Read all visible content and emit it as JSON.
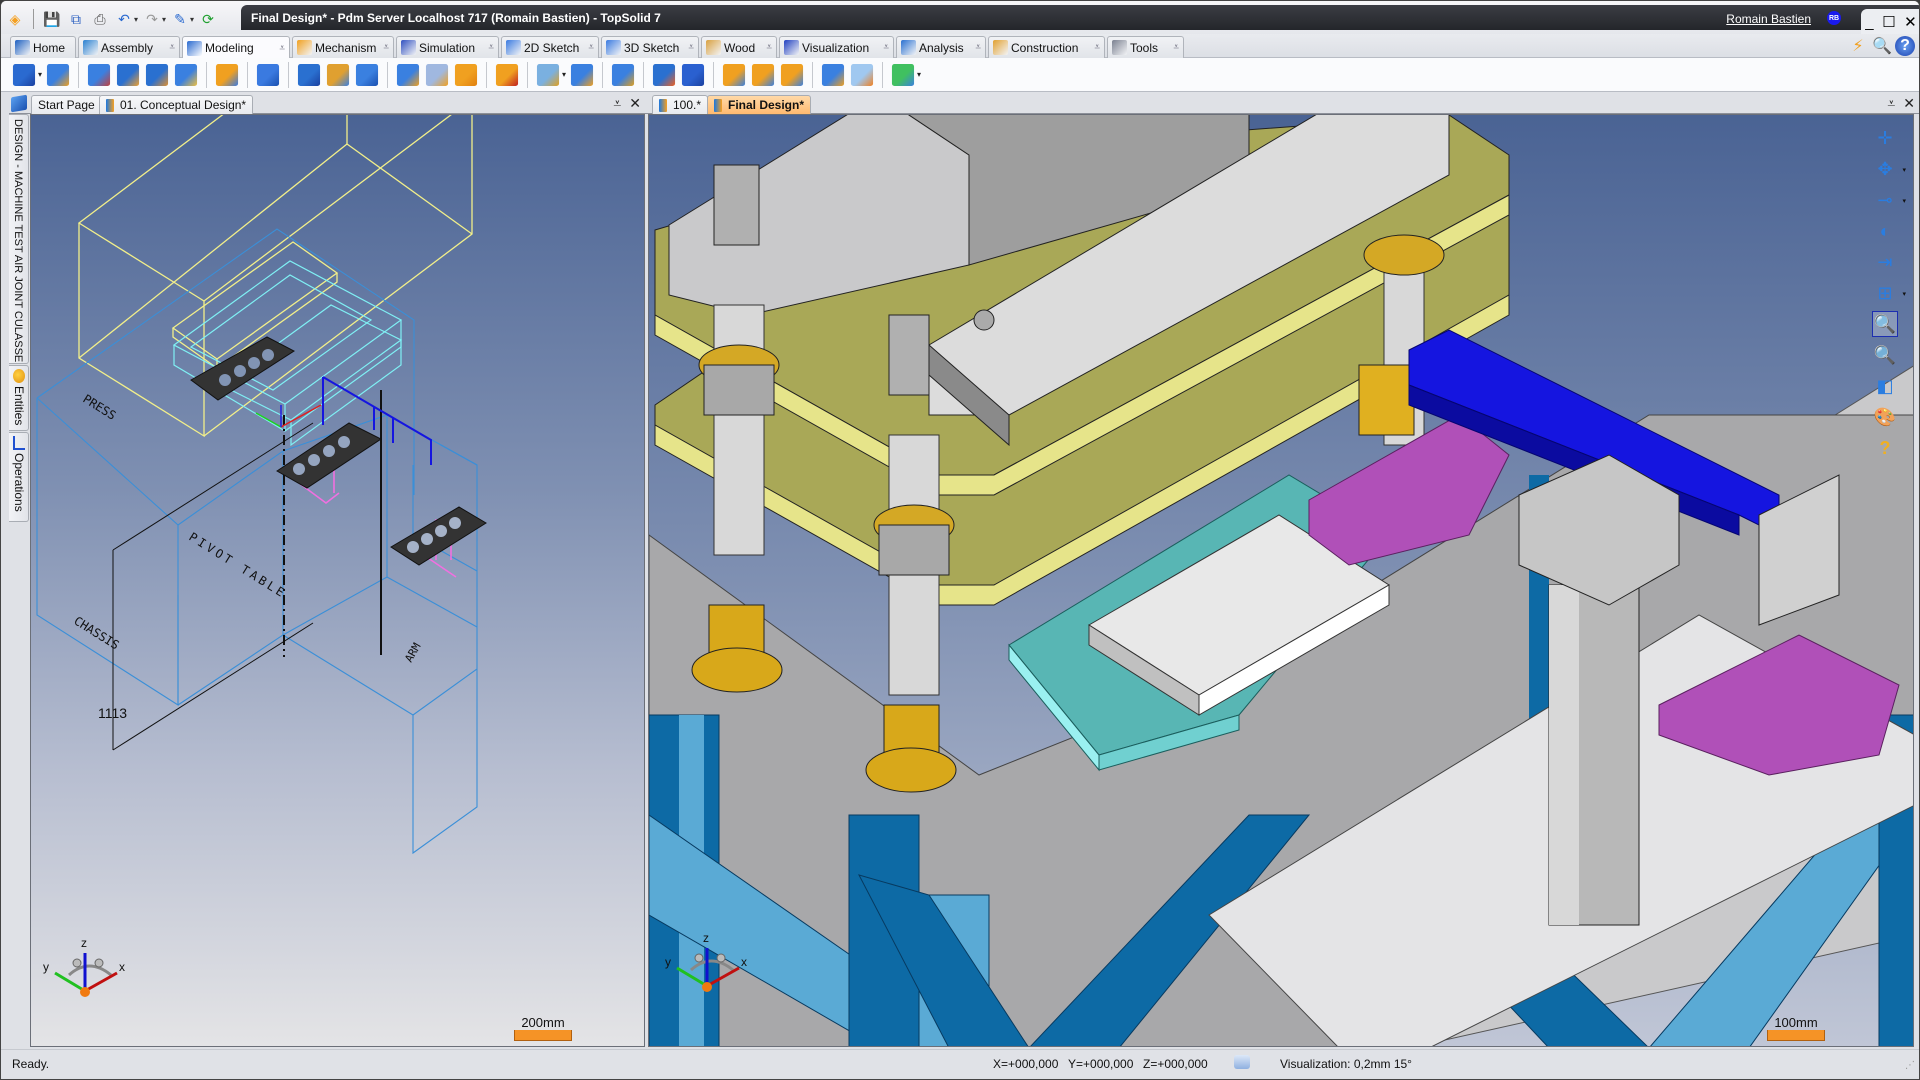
{
  "window": {
    "title": "Final Design* - Pdm Server Localhost 717 (Romain Bastien) - TopSolid 7",
    "user_name": "Romain Bastien",
    "user_initials": "RB",
    "controls": {
      "minimize": "_",
      "maximize": "☐",
      "close": "✕"
    }
  },
  "quick_access": [
    {
      "name": "app-logo-icon",
      "glyph": "◈",
      "color": "#f5a020"
    },
    {
      "name": "save-icon",
      "glyph": "💾",
      "color": "#2a5fc0"
    },
    {
      "name": "save-all-icon",
      "glyph": "⧉",
      "color": "#2a5fc0"
    },
    {
      "name": "print-icon",
      "glyph": "⎙",
      "color": "#555"
    },
    {
      "name": "undo-icon",
      "glyph": "↶",
      "color": "#2a6ad0"
    },
    {
      "name": "redo-icon",
      "glyph": "↷",
      "color": "#999"
    },
    {
      "name": "pen-icon",
      "glyph": "✎",
      "color": "#2a6ad0"
    },
    {
      "name": "refresh-icon",
      "glyph": "⟳",
      "color": "#20a030"
    }
  ],
  "ribbon": {
    "tabs": [
      {
        "label": "Home",
        "color": "#1d5fc0",
        "dropdown": false
      },
      {
        "label": "Assembly",
        "color": "#2a80d0",
        "dropdown": true
      },
      {
        "label": "Modeling",
        "color": "#2a6ad0",
        "dropdown": true,
        "active": true
      },
      {
        "label": "Mechanism",
        "color": "#f0a020",
        "dropdown": true
      },
      {
        "label": "Simulation",
        "color": "#3050c0",
        "dropdown": true
      },
      {
        "label": "2D Sketch",
        "color": "#3a7ae0",
        "dropdown": true
      },
      {
        "label": "3D Sketch",
        "color": "#3a7ae0",
        "dropdown": true
      },
      {
        "label": "Wood",
        "color": "#d8a040",
        "dropdown": true
      },
      {
        "label": "Visualization",
        "color": "#2040c0",
        "dropdown": true
      },
      {
        "label": "Analysis",
        "color": "#2a70d0",
        "dropdown": true
      },
      {
        "label": "Construction",
        "color": "#e0a030",
        "dropdown": true
      },
      {
        "label": "Tools",
        "color": "#7a8090",
        "dropdown": true
      }
    ],
    "right_buttons": [
      {
        "name": "connect-icon",
        "glyph": "⚡"
      },
      {
        "name": "search-icon",
        "glyph": "🔍"
      },
      {
        "name": "help-icon",
        "glyph": "?"
      }
    ]
  },
  "toolbar": {
    "groups": [
      [
        {
          "name": "sketch-part-icon",
          "c1": "#2a6ad0",
          "c2": "#1a40a0",
          "dd": true
        },
        {
          "name": "edit-sketch-icon",
          "c1": "#3a80e0",
          "c2": "#f0a020",
          "dd": false
        }
      ],
      [
        {
          "name": "extrude-profile-icon",
          "c1": "#3a80e0",
          "c2": "#c04040",
          "dd": false
        },
        {
          "name": "extrude-icon",
          "c1": "#2a70d0",
          "c2": "#f0a030",
          "dd": false
        },
        {
          "name": "revolve-icon",
          "c1": "#2a70d0",
          "c2": "#e09030",
          "dd": false
        },
        {
          "name": "shell-icon",
          "c1": "#3a80e0",
          "c2": "#f0c040",
          "dd": false
        }
      ],
      [
        {
          "name": "sweep-icon",
          "c1": "#f0a020",
          "c2": "#3a7ae0",
          "dd": false
        }
      ],
      [
        {
          "name": "layers-icon",
          "c1": "#3a7ae0",
          "c2": "#1a50b0",
          "dd": false
        }
      ],
      [
        {
          "name": "box-icon",
          "c1": "#2a70d0",
          "c2": "#1a40a0",
          "dd": false
        },
        {
          "name": "pattern-icon",
          "c1": "#e0a030",
          "c2": "#3a80e0",
          "dd": false
        },
        {
          "name": "repeat-icon",
          "c1": "#3a80e0",
          "c2": "#1a50b0",
          "dd": false
        }
      ],
      [
        {
          "name": "boolean-icon",
          "c1": "#3a80e0",
          "c2": "#f0a020",
          "dd": false
        },
        {
          "name": "intersect-icon",
          "c1": "#a0b8e0",
          "c2": "#f0a020",
          "dd": false
        },
        {
          "name": "pipe-icon",
          "c1": "#f0a020",
          "c2": "#e08010",
          "dd": false
        }
      ],
      [
        {
          "name": "array-icon",
          "c1": "#f0a020",
          "c2": "#c02020",
          "dd": false
        }
      ],
      [
        {
          "name": "spring-icon",
          "c1": "#7ab0e0",
          "c2": "#e0a020",
          "dd": true
        },
        {
          "name": "fastener-icon",
          "c1": "#3a80e0",
          "c2": "#f0a020",
          "dd": false
        }
      ],
      [
        {
          "name": "insert-icon",
          "c1": "#3a80e0",
          "c2": "#e0a020",
          "dd": false
        }
      ],
      [
        {
          "name": "solid-icon",
          "c1": "#2a70d0",
          "c2": "#f06020",
          "dd": false
        },
        {
          "name": "text-solid-icon",
          "c1": "#2a60d0",
          "c2": "#1a40a0",
          "dd": false
        }
      ],
      [
        {
          "name": "fillet-icon",
          "c1": "#f0a020",
          "c2": "#3a80e0",
          "dd": false
        },
        {
          "name": "chamfer-icon",
          "c1": "#f0a020",
          "c2": "#3a80e0",
          "dd": false
        },
        {
          "name": "draft-icon",
          "c1": "#f0a020",
          "c2": "#3a80e0",
          "dd": false
        }
      ],
      [
        {
          "name": "stack-icon",
          "c1": "#3a80e0",
          "c2": "#f0a020",
          "dd": false
        },
        {
          "name": "cut-icon",
          "c1": "#a0c8f0",
          "c2": "#f08020",
          "dd": false
        }
      ],
      [
        {
          "name": "inspect-icon",
          "c1": "#40c060",
          "c2": "#3a80e0",
          "dd": true
        }
      ]
    ]
  },
  "left_panel": {
    "tabs": [
      {
        "label": "Start Page",
        "active": false,
        "doc_icon": false
      },
      {
        "label": "01. Conceptual Design*",
        "active": false,
        "doc_icon": true
      }
    ],
    "side_tabs": [
      {
        "label": "DESIGN - MACHINE TEST AIR JOINT CULASSE"
      },
      {
        "label": "Entities"
      },
      {
        "label": "Operations"
      }
    ],
    "viewport": {
      "labels": {
        "press": "PRESS",
        "pivot_table": "PIVOT TABLE",
        "chassis": "CHASSIS",
        "arm": "ARM"
      },
      "dimension": "1113",
      "scale": "200mm",
      "axes": {
        "x": "x",
        "y": "y",
        "z": "z"
      }
    }
  },
  "right_panel": {
    "tabs": [
      {
        "label": "100.*",
        "active": false
      },
      {
        "label": "Final Design*",
        "active": true
      }
    ],
    "scale": "100mm",
    "axes": {
      "x": "x",
      "y": "y",
      "z": "z"
    },
    "view_tools": [
      {
        "name": "pan-icon",
        "glyph": "✛",
        "dd": false,
        "selected": false
      },
      {
        "name": "rotate-icon",
        "glyph": "✥",
        "dd": true,
        "selected": false
      },
      {
        "name": "camera-icon",
        "glyph": "⊸",
        "dd": true,
        "selected": false
      },
      {
        "name": "light-icon",
        "glyph": "◐",
        "dd": false,
        "selected": false
      },
      {
        "name": "section-lock-icon",
        "glyph": "⇥",
        "dd": false,
        "selected": false
      },
      {
        "name": "viewports-icon",
        "glyph": "⊞",
        "dd": true,
        "selected": false
      },
      {
        "name": "zoom-window-icon",
        "glyph": "🔍",
        "dd": false,
        "selected": true
      },
      {
        "name": "zoom-icon",
        "glyph": "🔍",
        "dd": false,
        "selected": false
      },
      {
        "name": "view-cube-icon",
        "glyph": "◧",
        "dd": false,
        "selected": false
      },
      {
        "name": "palette-icon",
        "glyph": "🎨",
        "dd": false,
        "selected": false
      },
      {
        "name": "layer-help-icon",
        "glyph": "?",
        "dd": false,
        "selected": false
      }
    ]
  },
  "statusbar": {
    "status": "Ready.",
    "x": "X=+000,000",
    "y": "Y=+000,000",
    "z": "Z=+000,000",
    "visualization": "Visualization: 0,2mm 15°"
  },
  "colors": {
    "accent_active_tab": "#ffba70",
    "scale_bar": "#f59326",
    "press_wire": "#f2ef8a",
    "pivot_wire": "#7ff0f4",
    "chassis_wire": "#3a8fd8",
    "arm_wire": "#1010e0",
    "gripper_wire": "#f070e0",
    "frame_blue": "#0d6aa5",
    "frame_light": "#5aaad5",
    "plate_olive": "#a9a857",
    "plate_yellow": "#e6e48a",
    "teal": "#58b6b4",
    "purple": "#b050b8",
    "arm_blue": "#1515e0",
    "gold": "#d8a81a"
  }
}
